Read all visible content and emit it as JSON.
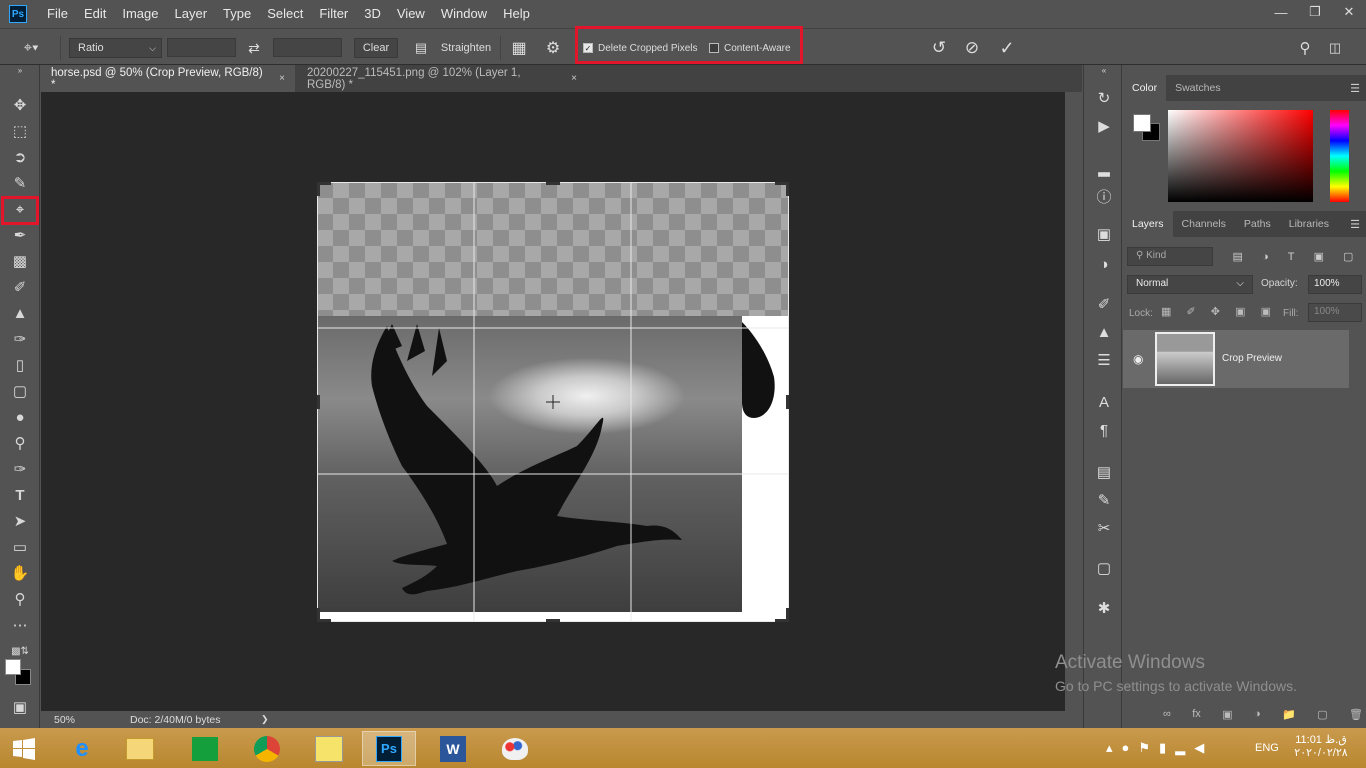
{
  "app": {
    "logo": "Ps",
    "menu": [
      "File",
      "Edit",
      "Image",
      "Layer",
      "Type",
      "Select",
      "Filter",
      "3D",
      "View",
      "Window",
      "Help"
    ]
  },
  "options": {
    "ratio": "Ratio",
    "clear": "Clear",
    "straighten": "Straighten",
    "delete_cropped_pixels": "Delete Cropped Pixels",
    "delete_cropped_checked": true,
    "content_aware": "Content-Aware",
    "content_aware_checked": false
  },
  "tabs": [
    {
      "label": "horse.psd @ 50% (Crop Preview, RGB/8) *",
      "close": "×"
    },
    {
      "label": "20200227_115451.png @ 102% (Layer 1, RGB/8) *",
      "close": "×"
    }
  ],
  "status": {
    "zoom": "50%",
    "doc": "Doc: 2/40M/0 bytes",
    "arrow": "❯"
  },
  "color_panel": {
    "tabs": [
      "Color",
      "Swatches"
    ],
    "hue_gradient": [
      "#ff0000",
      "#ffff00",
      "#00ff00",
      "#00ffff",
      "#0000ff",
      "#ff00ff",
      "#ff0000"
    ]
  },
  "layers_panel": {
    "tabs": [
      "Layers",
      "Channels",
      "Paths",
      "Libraries"
    ],
    "kind": "Kind",
    "blend_mode": "Normal",
    "opacity_label": "Opacity:",
    "opacity": "100%",
    "lock_label": "Lock:",
    "fill_label": "Fill:",
    "fill": "100%",
    "layer_name": "Crop Preview"
  },
  "watermark": {
    "title": "Activate Windows",
    "subtitle": "Go to PC settings to activate Windows."
  },
  "taskbar": {
    "lang": "ENG",
    "time": "11:01 ق.ظ",
    "date": "۲۰۲۰/۰۲/۲۸"
  }
}
